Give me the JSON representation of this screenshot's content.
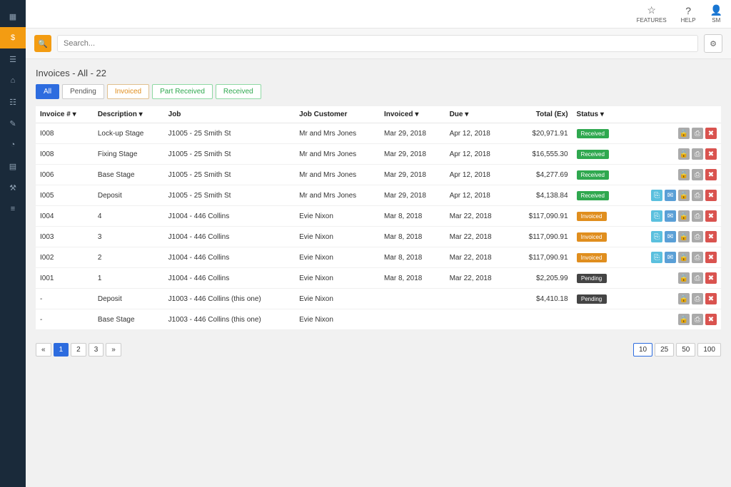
{
  "topbar": {
    "features": "FEATURES",
    "help": "HELP",
    "user": "SM"
  },
  "search": {
    "placeholder": "Search..."
  },
  "page": {
    "title": "Invoices - All - 22"
  },
  "filters": {
    "all": "All",
    "pending": "Pending",
    "invoiced": "Invoiced",
    "part_received": "Part Received",
    "received": "Received"
  },
  "headers": {
    "invoice_no": "Invoice # ▾",
    "description": "Description ▾",
    "job": "Job",
    "job_customer": "Job Customer",
    "invoiced": "Invoiced ▾",
    "due": "Due ▾",
    "total_ex": "Total (Ex)",
    "status": "Status ▾"
  },
  "rows": [
    {
      "no": "I008",
      "desc": "Lock-up Stage",
      "job": "J1005 - 25 Smith St",
      "cust": "Mr and Mrs Jones",
      "invoiced": "Mar 29, 2018",
      "due": "Apr 12, 2018",
      "total": "$20,971.91",
      "status": "Received",
      "extra": 0
    },
    {
      "no": "I008",
      "desc": "Fixing Stage",
      "job": "J1005 - 25 Smith St",
      "cust": "Mr and Mrs Jones",
      "invoiced": "Mar 29, 2018",
      "due": "Apr 12, 2018",
      "total": "$16,555.30",
      "status": "Received",
      "extra": 0
    },
    {
      "no": "I006",
      "desc": "Base Stage",
      "job": "J1005 - 25 Smith St",
      "cust": "Mr and Mrs Jones",
      "invoiced": "Mar 29, 2018",
      "due": "Apr 12, 2018",
      "total": "$4,277.69",
      "status": "Received",
      "extra": 0
    },
    {
      "no": "I005",
      "desc": "Deposit",
      "job": "J1005 - 25 Smith St",
      "cust": "Mr and Mrs Jones",
      "invoiced": "Mar 29, 2018",
      "due": "Apr 12, 2018",
      "total": "$4,138.84",
      "status": "Received",
      "extra": 2
    },
    {
      "no": "I004",
      "desc": "4",
      "job": "J1004 - 446 Collins",
      "cust": "Evie Nixon",
      "invoiced": "Mar 8, 2018",
      "due": "Mar 22, 2018",
      "total": "$117,090.91",
      "status": "Invoiced",
      "extra": 2
    },
    {
      "no": "I003",
      "desc": "3",
      "job": "J1004 - 446 Collins",
      "cust": "Evie Nixon",
      "invoiced": "Mar 8, 2018",
      "due": "Mar 22, 2018",
      "total": "$117,090.91",
      "status": "Invoiced",
      "extra": 2
    },
    {
      "no": "I002",
      "desc": "2",
      "job": "J1004 - 446 Collins",
      "cust": "Evie Nixon",
      "invoiced": "Mar 8, 2018",
      "due": "Mar 22, 2018",
      "total": "$117,090.91",
      "status": "Invoiced",
      "extra": 2
    },
    {
      "no": "I001",
      "desc": "1",
      "job": "J1004 - 446 Collins",
      "cust": "Evie Nixon",
      "invoiced": "Mar 8, 2018",
      "due": "Mar 22, 2018",
      "total": "$2,205.99",
      "status": "Pending",
      "extra": 0
    },
    {
      "no": "-",
      "desc": "Deposit",
      "job": "J1003 - 446 Collins (this one)",
      "cust": "Evie Nixon",
      "invoiced": "",
      "due": "",
      "total": "$4,410.18",
      "status": "Pending",
      "extra": 0
    },
    {
      "no": "-",
      "desc": "Base Stage",
      "job": "J1003 - 446 Collins (this one)",
      "cust": "Evie Nixon",
      "invoiced": "",
      "due": "",
      "total": "",
      "status": "",
      "extra": 0
    }
  ],
  "pagination": [
    "«",
    "1",
    "2",
    "3",
    "»"
  ],
  "page_sizes": [
    "10",
    "25",
    "50",
    "100"
  ]
}
